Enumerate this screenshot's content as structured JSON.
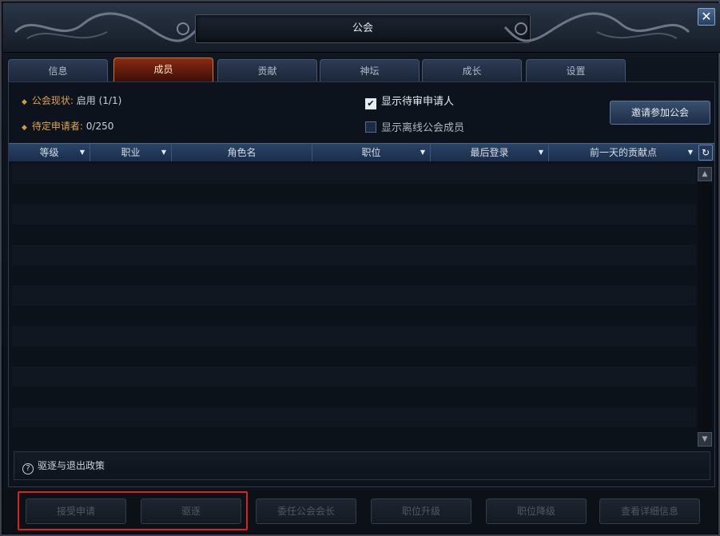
{
  "window": {
    "title": "公会",
    "close_label": "✕"
  },
  "tabs": [
    {
      "label": "信息",
      "active": false
    },
    {
      "label": "成员",
      "active": true
    },
    {
      "label": "贡献",
      "active": false
    },
    {
      "label": "神坛",
      "active": false
    },
    {
      "label": "成长",
      "active": false
    },
    {
      "label": "设置",
      "active": false
    }
  ],
  "status": {
    "guild_state_label": "公会现状:",
    "guild_state_value": "启用 (1/1)",
    "pending_label": "待定申请者:",
    "pending_value": "0/250"
  },
  "filters": {
    "show_pending": {
      "label": "显示待审申请人",
      "checked": true
    },
    "show_offline": {
      "label": "显示离线公会成员",
      "checked": false
    }
  },
  "invite_button": "邀请参加公会",
  "columns": [
    {
      "label": "等级",
      "sortable": true
    },
    {
      "label": "职业",
      "sortable": true
    },
    {
      "label": "角色名",
      "sortable": false
    },
    {
      "label": "职位",
      "sortable": true
    },
    {
      "label": "最后登录",
      "sortable": true
    },
    {
      "label": "前一天的贡献点",
      "sortable": true
    }
  ],
  "refresh_icon": "↻",
  "rows": [],
  "policy_text": "驱逐与退出政策",
  "actions": [
    {
      "label": "接受申请",
      "enabled": false
    },
    {
      "label": "驱逐",
      "enabled": false
    },
    {
      "label": "委任公会会长",
      "enabled": false
    },
    {
      "label": "职位升级",
      "enabled": false
    },
    {
      "label": "职位降级",
      "enabled": false
    },
    {
      "label": "查看详细信息",
      "enabled": false
    }
  ]
}
